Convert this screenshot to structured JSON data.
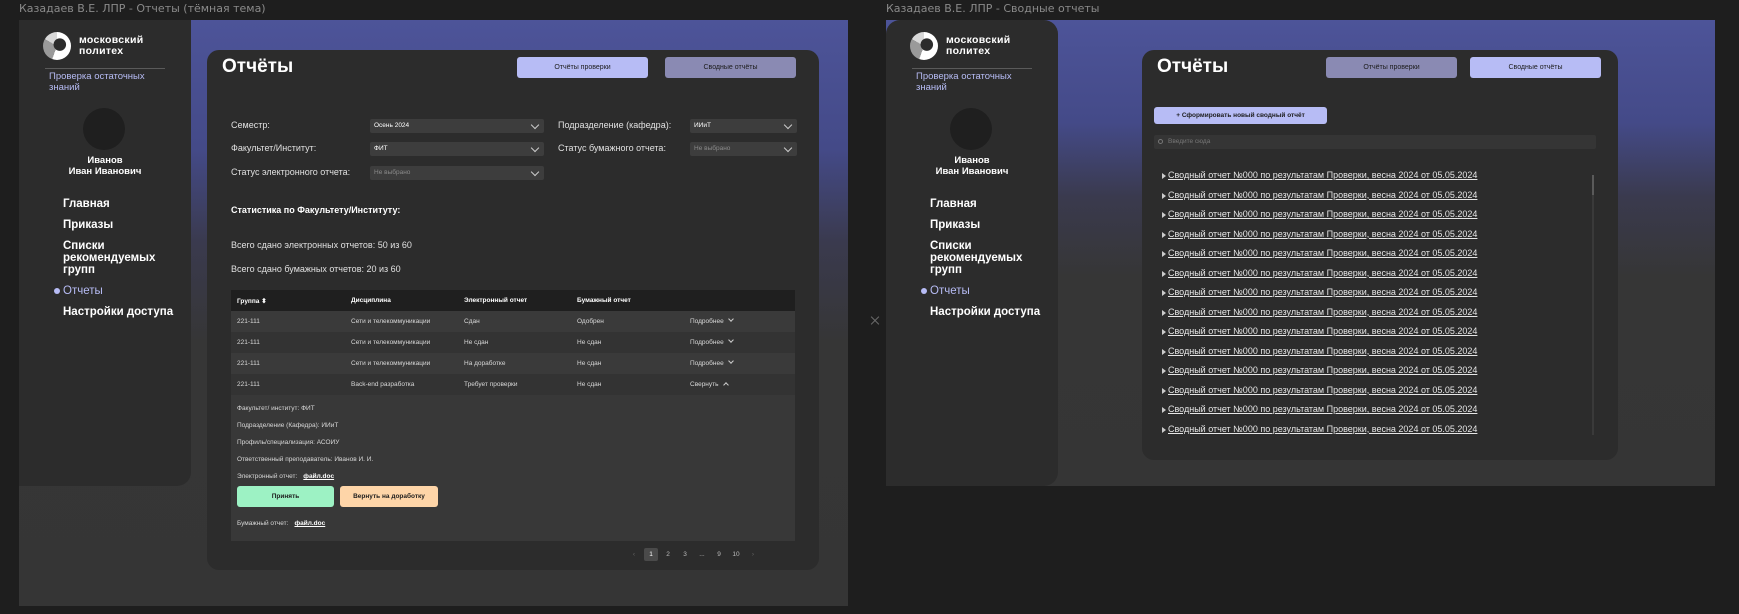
{
  "frames": [
    {
      "label": "Казадаев В.Е. ЛПР - Отчеты (тёмная тема)"
    },
    {
      "label": "Казадаев В.Е. ЛПР - Сводные отчеты"
    }
  ],
  "sidebar": {
    "logo_line1": "московский",
    "logo_line2": "политех",
    "app_title": "Проверка остаточных знаний",
    "user_name_line1": "Иванов",
    "user_name_line2": "Иван Иванович",
    "nav": [
      {
        "label": "Главная"
      },
      {
        "label": "Приказы"
      },
      {
        "label": "Списки рекомендуемых групп"
      },
      {
        "label": "Отчеты",
        "active": true
      },
      {
        "label": "Настройки доступа"
      }
    ]
  },
  "reports_page": {
    "title": "Отчёты",
    "tab_checks": "Отчёты проверки",
    "tab_summary": "Сводные отчёты",
    "filters": {
      "semester_label": "Семестр:",
      "semester_value": "Осень 2024",
      "department_label": "Подразделение (кафедра):",
      "department_value": "ИИиТ",
      "faculty_label": "Факультет/Институт:",
      "faculty_value": "ФИТ",
      "paper_status_label": "Статус бумажного отчета:",
      "paper_status_placeholder": "Не выбрано",
      "electronic_status_label": "Статус электронного отчета:",
      "electronic_status_placeholder": "Не выбрано"
    },
    "stats_title": "Статистика по Факультету/Институту:",
    "stat_electronic": "Всего сдано электронных отчетов: 50 из 60",
    "stat_paper": "Всего сдано бумажных отчетов: 20 из 60",
    "table": {
      "headers": [
        "Группа ⬍",
        "Дисциплина",
        "Электронный отчет",
        "Бумажный отчет"
      ],
      "rows": [
        {
          "group": "221-111",
          "discipline": "Сети и телекоммуникации",
          "electronic": "Сдан",
          "paper": "Одобрен",
          "action": "Подробнее"
        },
        {
          "group": "221-111",
          "discipline": "Сети и телекоммуникации",
          "electronic": "Не сдан",
          "paper": "Не сдан",
          "action": "Подробнее"
        },
        {
          "group": "221-111",
          "discipline": "Сети и телекоммуникации",
          "electronic": "На доработке",
          "paper": "Не сдан",
          "action": "Подробнее"
        },
        {
          "group": "221-111",
          "discipline": "Back-end разработка",
          "electronic": "Требует проверки",
          "paper": "Не сдан",
          "action": "Свернуть"
        }
      ],
      "details": {
        "faculty": "Факультет/ институт: ФИТ",
        "department": "Подразделение (Кафедра): ИИиТ",
        "profile": "Профиль/специализация: АСОИУ",
        "teacher": "Ответственный преподаватель: Иванов И. И.",
        "electronic_label": "Электронный отчет:",
        "electronic_file": "файл.doc",
        "accept_button": "Принять",
        "return_button": "Вернуть на доработку",
        "paper_label": "Бумажный отчет:",
        "paper_file": "файл.doc"
      }
    },
    "pagination": [
      "‹",
      "1",
      "2",
      "3",
      "...",
      "9",
      "10",
      "›"
    ]
  },
  "summary_page": {
    "title": "Отчёты",
    "tab_checks": "Отчёты проверки",
    "tab_summary": "Сводные отчёты",
    "new_button": "+ Сформировать новый сводный отчёт",
    "search_placeholder": "Введите сюда",
    "reports": [
      "Сводный отчет №000 по результатам Проверки, весна 2024 от 05.05.2024",
      "Сводный отчет №000 по результатам Проверки, весна 2024 от 05.05.2024",
      "Сводный отчет №000 по результатам Проверки, весна 2024 от 05.05.2024",
      "Сводный отчет №000 по результатам Проверки, весна 2024 от 05.05.2024",
      "Сводный отчет №000 по результатам Проверки, весна 2024 от 05.05.2024",
      "Сводный отчет №000 по результатам Проверки, весна 2024 от 05.05.2024",
      "Сводный отчет №000 по результатам Проверки, весна 2024 от 05.05.2024",
      "Сводный отчет №000 по результатам Проверки, весна 2024 от 05.05.2024",
      "Сводный отчет №000 по результатам Проверки, весна 2024 от 05.05.2024",
      "Сводный отчет №000 по результатам Проверки, весна 2024 от 05.05.2024",
      "Сводный отчет №000 по результатам Проверки, весна 2024 от 05.05.2024",
      "Сводный отчет №000 по результатам Проверки, весна 2024 от 05.05.2024",
      "Сводный отчет №000 по результатам Проверки, весна 2024 от 05.05.2024",
      "Сводный отчет №000 по результатам Проверки, весна 2024 от 05.05.2024"
    ]
  },
  "colors": {
    "accent": "#b7bcf5",
    "accept": "#9df2c4",
    "return": "#fed5a8",
    "panel": "#2c2c2c",
    "gradient_top": "#4d5499"
  }
}
